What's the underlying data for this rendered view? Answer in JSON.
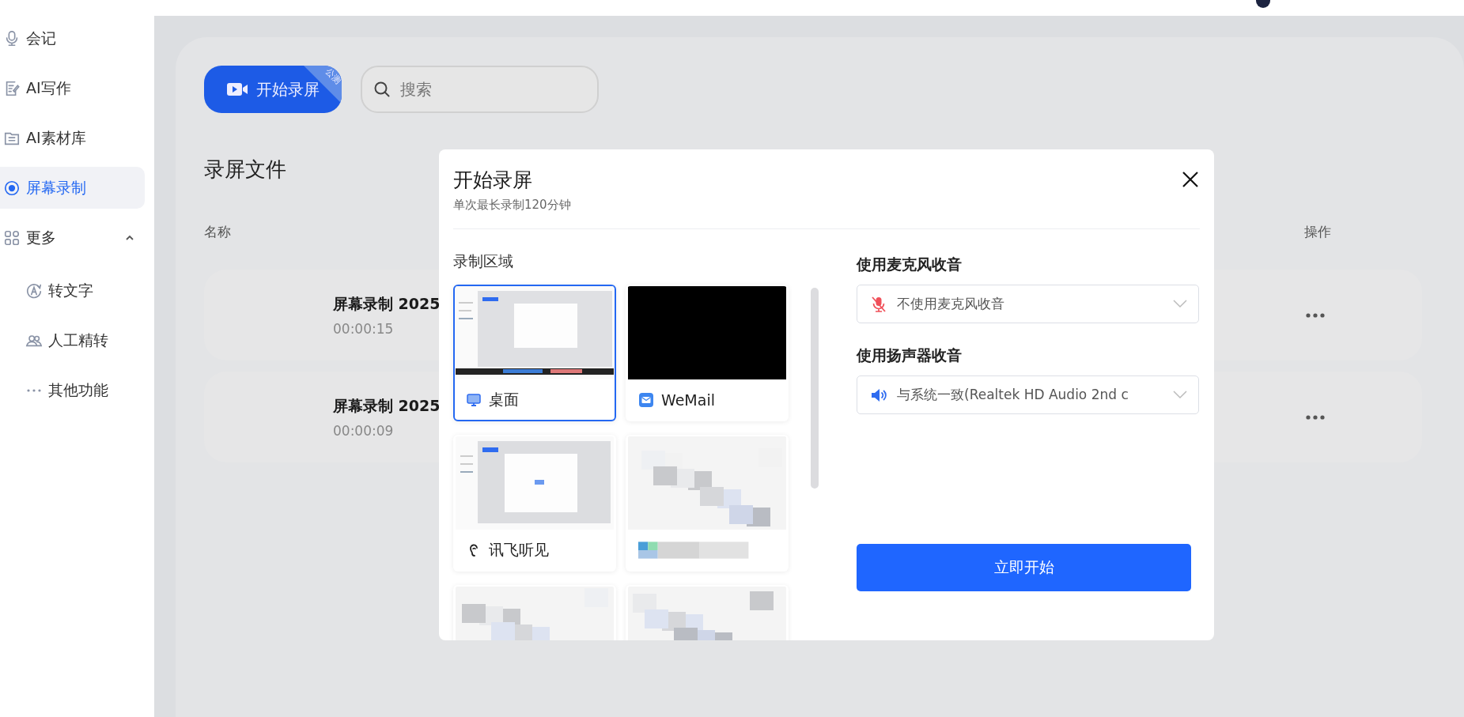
{
  "sidebar": {
    "items": [
      {
        "label": "会记",
        "selected": false
      },
      {
        "label": "AI写作",
        "selected": false
      },
      {
        "label": "AI素材库",
        "selected": false
      },
      {
        "label": "屏幕录制",
        "selected": true
      },
      {
        "label": "更多",
        "selected": false,
        "expanded": true,
        "children": [
          {
            "label": "转文字",
            "selected": false
          },
          {
            "label": "人工精转",
            "selected": false
          },
          {
            "label": "其他功能",
            "selected": false
          }
        ]
      }
    ]
  },
  "toolbar": {
    "start_button": "开始录屏",
    "badge": "公测",
    "search": {
      "placeholder": "搜索"
    }
  },
  "files": {
    "title": "录屏文件",
    "columns": [
      "名称",
      "操作"
    ],
    "rows": [
      {
        "name": "屏幕录制 2025",
        "duration": "00:00:15"
      },
      {
        "name": "屏幕录制 2025",
        "duration": "00:00:09"
      }
    ]
  },
  "dialog": {
    "title": "开始录屏",
    "subtitle": "单次最长录制120分钟",
    "area_label": "录制区域",
    "sources": [
      {
        "kind": "desktop",
        "label": "桌面",
        "selected": true
      },
      {
        "kind": "mail",
        "label": "WeMail",
        "selected": false
      },
      {
        "kind": "app",
        "label": "讯飞听见",
        "selected": false
      },
      {
        "kind": "blurred",
        "selected": false
      },
      {
        "kind": "partial",
        "selected": false
      },
      {
        "kind": "partial",
        "selected": false
      }
    ],
    "microphone": {
      "label": "使用麦克风收音",
      "value": "不使用麦克风收音",
      "muted": true
    },
    "speaker": {
      "label": "使用扬声器收音",
      "value": "与系统一致(Realtek HD Audio 2nd c"
    },
    "confirm_button": "立即开始"
  }
}
